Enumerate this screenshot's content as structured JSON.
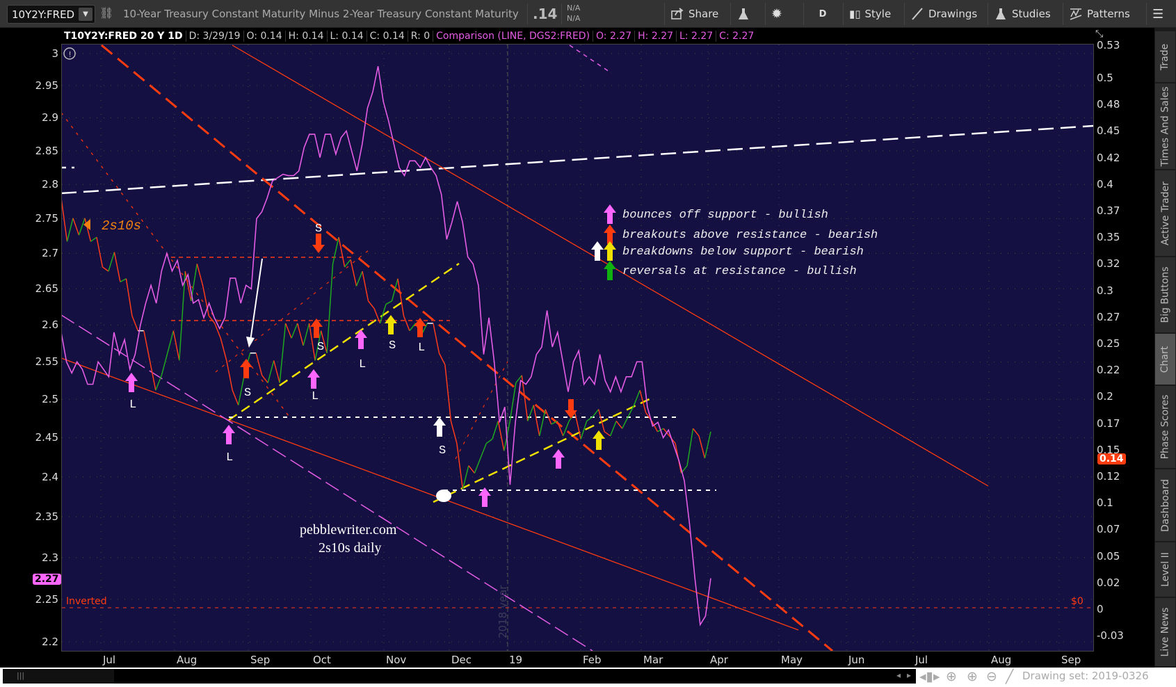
{
  "toolbar": {
    "symbol": "10Y2Y:FRED",
    "description": "10-Year Treasury Constant Maturity Minus 2-Year Treasury Constant Maturity",
    "last": ".14",
    "na_top": "N/A",
    "na_bottom": "N/A",
    "share": "Share",
    "period": "D",
    "style": "Style",
    "drawings": "Drawings",
    "studies": "Studies",
    "patterns": "Patterns"
  },
  "infobar": {
    "title": "T10Y2Y:FRED 20 Y 1D",
    "date": "D: 3/29/19",
    "open": "O: 0.14",
    "high": "H: 0.14",
    "low": "L: 0.14",
    "close": "C: 0.14",
    "range": "R: 0",
    "comparison": "Comparison (LINE, DGS2:FRED)",
    "c_open": "O: 2.27",
    "c_high": "H: 2.27",
    "c_low": "L: 2.27",
    "c_close": "C: 2.27"
  },
  "side_tabs": [
    "Trade",
    "Times And Sales",
    "Active Trader",
    "Big Buttons",
    "Chart",
    "Phase Scores",
    "Dashboard",
    "Level II",
    "Live News"
  ],
  "bottom": {
    "drawing_set": "Drawing set: 2019-0326"
  },
  "colors": {
    "background": "#141142",
    "spread": "#ff3b1a",
    "spread_up": "#1fa81f",
    "comparison": "#e45ce4",
    "pink": "#ff66ff",
    "red": "#ff3b10",
    "yellow": "#f0e000",
    "white": "#ffffff",
    "green": "#10b010"
  },
  "annotations": {
    "series_label": "2s10s",
    "watermark_1": "pebblewriter.com",
    "watermark_2": "2s10s daily",
    "inverted": "Inverted",
    "zero": "$0",
    "year_marker": "2018 year",
    "legend": [
      {
        "text": "bounces off support - bullish",
        "arrows": [
          "pink"
        ]
      },
      {
        "text": "breakouts above resistance - bearish",
        "arrows": [
          "red"
        ]
      },
      {
        "text": "breakdowns below support - bearish",
        "arrows": [
          "white",
          "yellow"
        ]
      },
      {
        "text": "reversals at resistance - bullish",
        "arrows": [
          "green"
        ]
      }
    ],
    "markers": [
      {
        "color": "pink",
        "dir": "up",
        "label": "L"
      },
      {
        "color": "pink",
        "dir": "up",
        "label": "L"
      },
      {
        "color": "red",
        "dir": "up",
        "label": "S"
      },
      {
        "color": "pink",
        "dir": "up",
        "label": "L"
      },
      {
        "color": "red",
        "dir": "down",
        "label": "S"
      },
      {
        "color": "red",
        "dir": "up",
        "label": "S"
      },
      {
        "color": "pink",
        "dir": "up",
        "label": "L"
      },
      {
        "color": "yellow",
        "dir": "up",
        "label": "S"
      },
      {
        "color": "red",
        "dir": "up",
        "label": "L"
      },
      {
        "color": "white",
        "dir": "up",
        "label": "S"
      },
      {
        "color": "pink",
        "dir": "up",
        "label": ""
      },
      {
        "color": "pink",
        "dir": "up",
        "label": ""
      },
      {
        "color": "red",
        "dir": "down",
        "label": ""
      },
      {
        "color": "yellow",
        "dir": "up",
        "label": ""
      }
    ]
  },
  "chart_data": {
    "type": "line",
    "title": "T10Y2Y:FRED 20 Y 1D",
    "x_range": [
      "2018-06-13",
      "2019-03-29"
    ],
    "x_ticks": [
      "Jul",
      "Aug",
      "Sep",
      "Oct",
      "Nov",
      "Dec",
      "19",
      "Feb",
      "Mar",
      "Apr",
      "May",
      "Jun",
      "Jul",
      "Aug",
      "Sep"
    ],
    "left_axis": {
      "label": "DGS2",
      "scale": "log",
      "ticks": [
        "3",
        "2.95",
        "2.9",
        "2.85",
        "2.8",
        "2.75",
        "2.7",
        "2.65",
        "2.6",
        "2.55",
        "2.5",
        "2.45",
        "2.4",
        "2.35",
        "2.3",
        "2.25",
        "2.2"
      ],
      "range": [
        2.18,
        3.02
      ],
      "last_value": "2.27"
    },
    "right_axis": {
      "label": "T10Y2Y",
      "ticks": [
        "0.53",
        "0.5",
        "0.48",
        "0.45",
        "0.42",
        "0.4",
        "0.37",
        "0.35",
        "0.32",
        "0.3",
        "0.27",
        "0.25",
        "0.22",
        "0.2",
        "0.17",
        "0.15",
        "0.12",
        "0.1",
        "0.07",
        "0.05",
        "0.02",
        "0",
        "-0.03"
      ],
      "range": [
        -0.04,
        0.53
      ],
      "last_value": "0.14"
    },
    "series": [
      {
        "name": "2s10s (T10Y2Y)",
        "axis": "right",
        "values": [
          0.387,
          0.346,
          0.368,
          0.352,
          0.368,
          0.346,
          0.35,
          0.322,
          0.318,
          0.336,
          0.308,
          0.311,
          0.276,
          0.262,
          0.262,
          0.234,
          0.206,
          0.22,
          0.241,
          0.262,
          0.234,
          0.318,
          0.29,
          0.325,
          0.304,
          0.276,
          0.269,
          0.255,
          0.234,
          0.206,
          0.192,
          0.22,
          0.241,
          0.241,
          0.22,
          0.213,
          0.234,
          0.213,
          0.269,
          0.255,
          0.269,
          0.248,
          0.269,
          0.234,
          0.262,
          0.241,
          0.325,
          0.35,
          0.322,
          0.329,
          0.304,
          0.318,
          0.29,
          0.283,
          0.269,
          0.287,
          0.29,
          0.311,
          0.276,
          0.262,
          0.269,
          0.258,
          0.269,
          0.269,
          0.241,
          0.23,
          0.177,
          0.156,
          0.113,
          0.135,
          0.128,
          0.142,
          0.156,
          0.16,
          0.177,
          0.149,
          0.177,
          0.213,
          0.22,
          0.177,
          0.192,
          0.163,
          0.188,
          0.174,
          0.177,
          0.163,
          0.177,
          0.185,
          0.16,
          0.177,
          0.181,
          0.188,
          0.167,
          0.163,
          0.177,
          0.17,
          0.181,
          0.192,
          0.206,
          0.185,
          0.177,
          0.167,
          0.17,
          0.163,
          0.156,
          0.128,
          0.135,
          0.17,
          0.163,
          0.142,
          0.167
        ]
      },
      {
        "name": "Comparison (DGS2)",
        "axis": "left",
        "values": [
          2.59,
          2.55,
          2.535,
          2.55,
          2.54,
          2.52,
          2.52,
          2.55,
          2.54,
          2.53,
          2.59,
          2.56,
          2.58,
          2.54,
          2.56,
          2.6,
          2.63,
          2.655,
          2.63,
          2.675,
          2.7,
          2.675,
          2.69,
          2.655,
          2.67,
          2.63,
          2.635,
          2.61,
          2.63,
          2.61,
          2.595,
          2.61,
          2.665,
          2.665,
          2.63,
          2.655,
          2.65,
          2.75,
          2.76,
          2.78,
          2.805,
          2.81,
          2.815,
          2.813,
          2.813,
          2.82,
          2.855,
          2.875,
          2.875,
          2.84,
          2.875,
          2.875,
          2.845,
          2.87,
          2.88,
          2.85,
          2.82,
          2.86,
          2.915,
          2.94,
          2.98,
          2.925,
          2.895,
          2.86,
          2.825,
          2.813,
          2.835,
          2.835,
          2.825,
          2.84,
          2.825,
          2.813,
          2.785,
          2.72,
          2.745,
          2.775,
          2.745,
          2.695,
          2.685,
          2.655,
          2.56,
          2.61,
          2.55,
          2.47,
          2.49,
          2.39,
          2.47,
          2.525,
          2.52,
          2.53,
          2.56,
          2.57,
          2.62,
          2.57,
          2.59,
          2.55,
          2.51,
          2.55,
          2.565,
          2.52,
          2.53,
          2.52,
          2.56,
          2.525,
          2.51,
          2.53,
          2.51,
          2.53,
          2.53,
          2.55,
          2.55,
          2.49,
          2.465,
          2.47,
          2.45,
          2.46,
          2.44,
          2.42,
          2.395,
          2.34,
          2.275,
          2.22,
          2.23,
          2.275
        ]
      }
    ]
  }
}
